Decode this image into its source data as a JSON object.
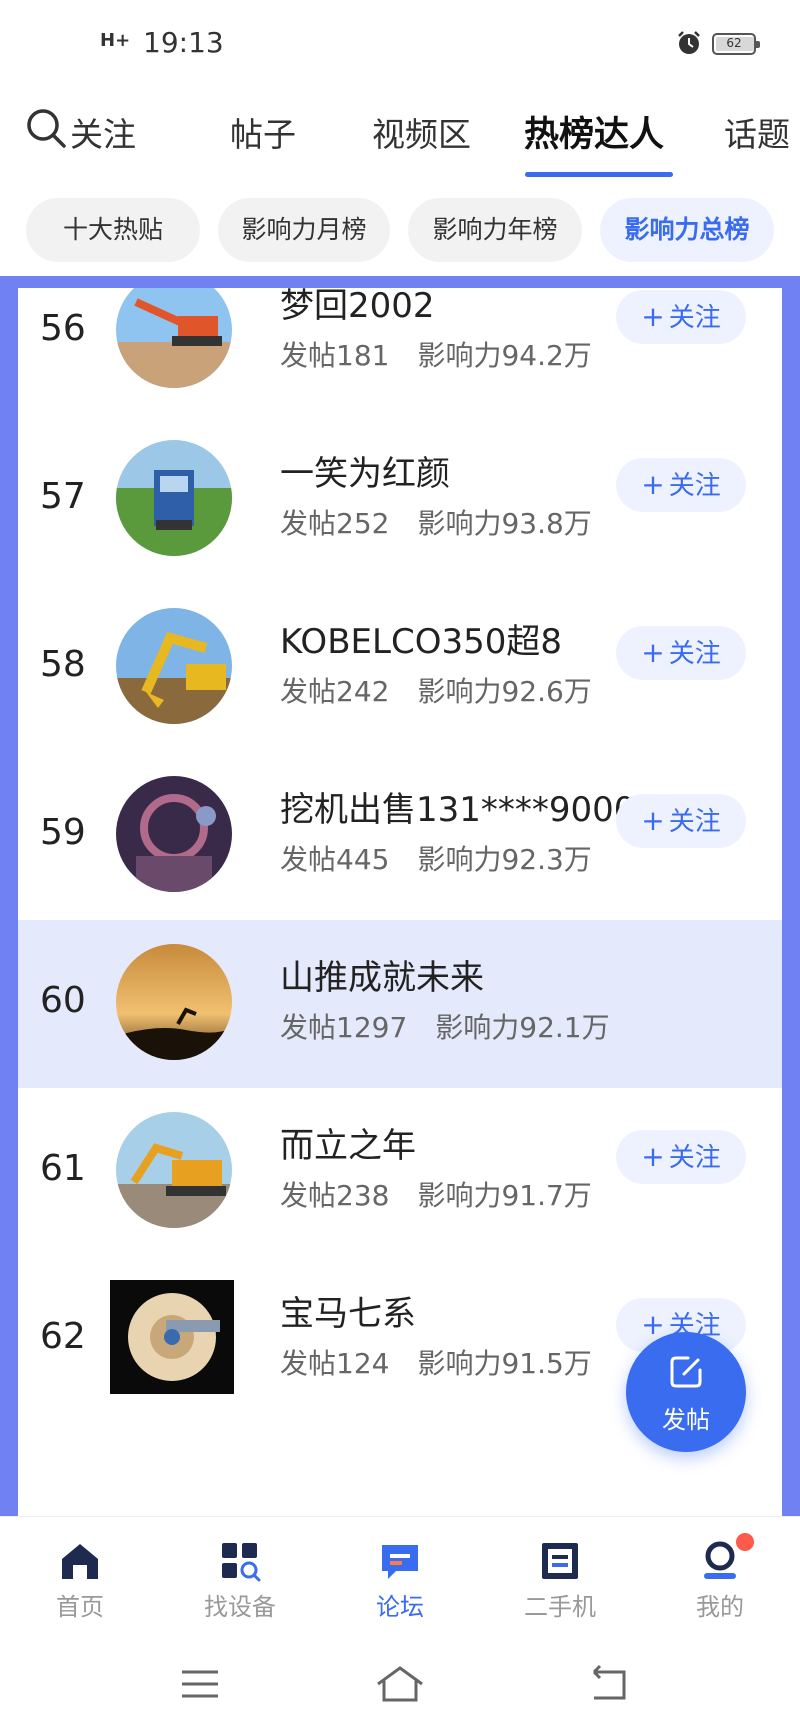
{
  "status_bar": {
    "signal": "H+",
    "time": "19:13",
    "battery": "62"
  },
  "top_tabs": [
    {
      "label": "关注",
      "visible_text": "关注"
    },
    {
      "label": "帖子"
    },
    {
      "label": "视频区"
    },
    {
      "label": "热榜达人"
    },
    {
      "label": "话题"
    }
  ],
  "chips": [
    "十大热贴",
    "影响力月榜",
    "影响力年榜",
    "影响力总榜"
  ],
  "follow_label": "关注",
  "rows": [
    {
      "rank": "56",
      "name": "梦回2002",
      "posts": "发帖181",
      "influence": "影响力94.2万"
    },
    {
      "rank": "57",
      "name": "一笑为红颜",
      "posts": "发帖252",
      "influence": "影响力93.8万"
    },
    {
      "rank": "58",
      "name": "KOBELCO350超8",
      "posts": "发帖242",
      "influence": "影响力92.6万"
    },
    {
      "rank": "59",
      "name": "挖机出售131****9000",
      "posts": "发帖445",
      "influence": "影响力92.3万"
    },
    {
      "rank": "60",
      "name": "山推成就未来",
      "posts": "发帖1297",
      "influence": "影响力92.1万"
    },
    {
      "rank": "61",
      "name": "而立之年",
      "posts": "发帖238",
      "influence": "影响力91.7万"
    },
    {
      "rank": "62",
      "name": "宝马七系",
      "posts": "发帖124",
      "influence": "影响力91.5万"
    }
  ],
  "fab": {
    "label": "发帖"
  },
  "bottom_nav": [
    {
      "label": "首页",
      "icon": "home-icon"
    },
    {
      "label": "找设备",
      "icon": "find-device-icon"
    },
    {
      "label": "论坛",
      "icon": "forum-icon"
    },
    {
      "label": "二手机",
      "icon": "used-machine-icon"
    },
    {
      "label": "我的",
      "icon": "profile-icon"
    }
  ],
  "colors": {
    "accent": "#3a6cf0",
    "frame": "#7082f3",
    "highlight_row": "#e4e9fb",
    "chip_bg": "#f2f2f2"
  }
}
